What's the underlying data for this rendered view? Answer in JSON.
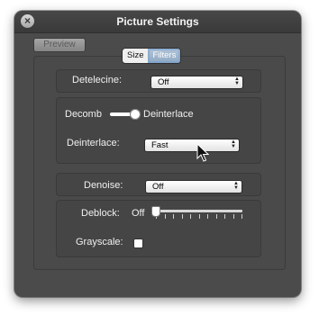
{
  "window": {
    "title": "Picture Settings",
    "close_icon": "close-icon"
  },
  "preview_button": {
    "label": "Preview"
  },
  "tabs": [
    {
      "label": "Size",
      "active": false
    },
    {
      "label": "Filters",
      "active": true
    }
  ],
  "filters": {
    "detelecine": {
      "label": "Detelecine:",
      "value": "Off"
    },
    "decomb_switch": {
      "left_label": "Decomb",
      "right_label": "Deinterlace",
      "state": "Deinterlace"
    },
    "deinterlace": {
      "label": "Deinterlace:",
      "value": "Fast"
    },
    "denoise": {
      "label": "Denoise:",
      "value": "Off"
    },
    "deblock": {
      "label": "Deblock:",
      "value_text": "Off",
      "level": 0
    },
    "grayscale": {
      "label": "Grayscale:",
      "checked": false
    }
  },
  "colors": {
    "hud_background": "#4b4b4b",
    "active_tab": "#8fa8c3"
  },
  "icons": {
    "popup_arrows": "up-down-arrows-icon",
    "pointer": "mouse-pointer-icon"
  }
}
